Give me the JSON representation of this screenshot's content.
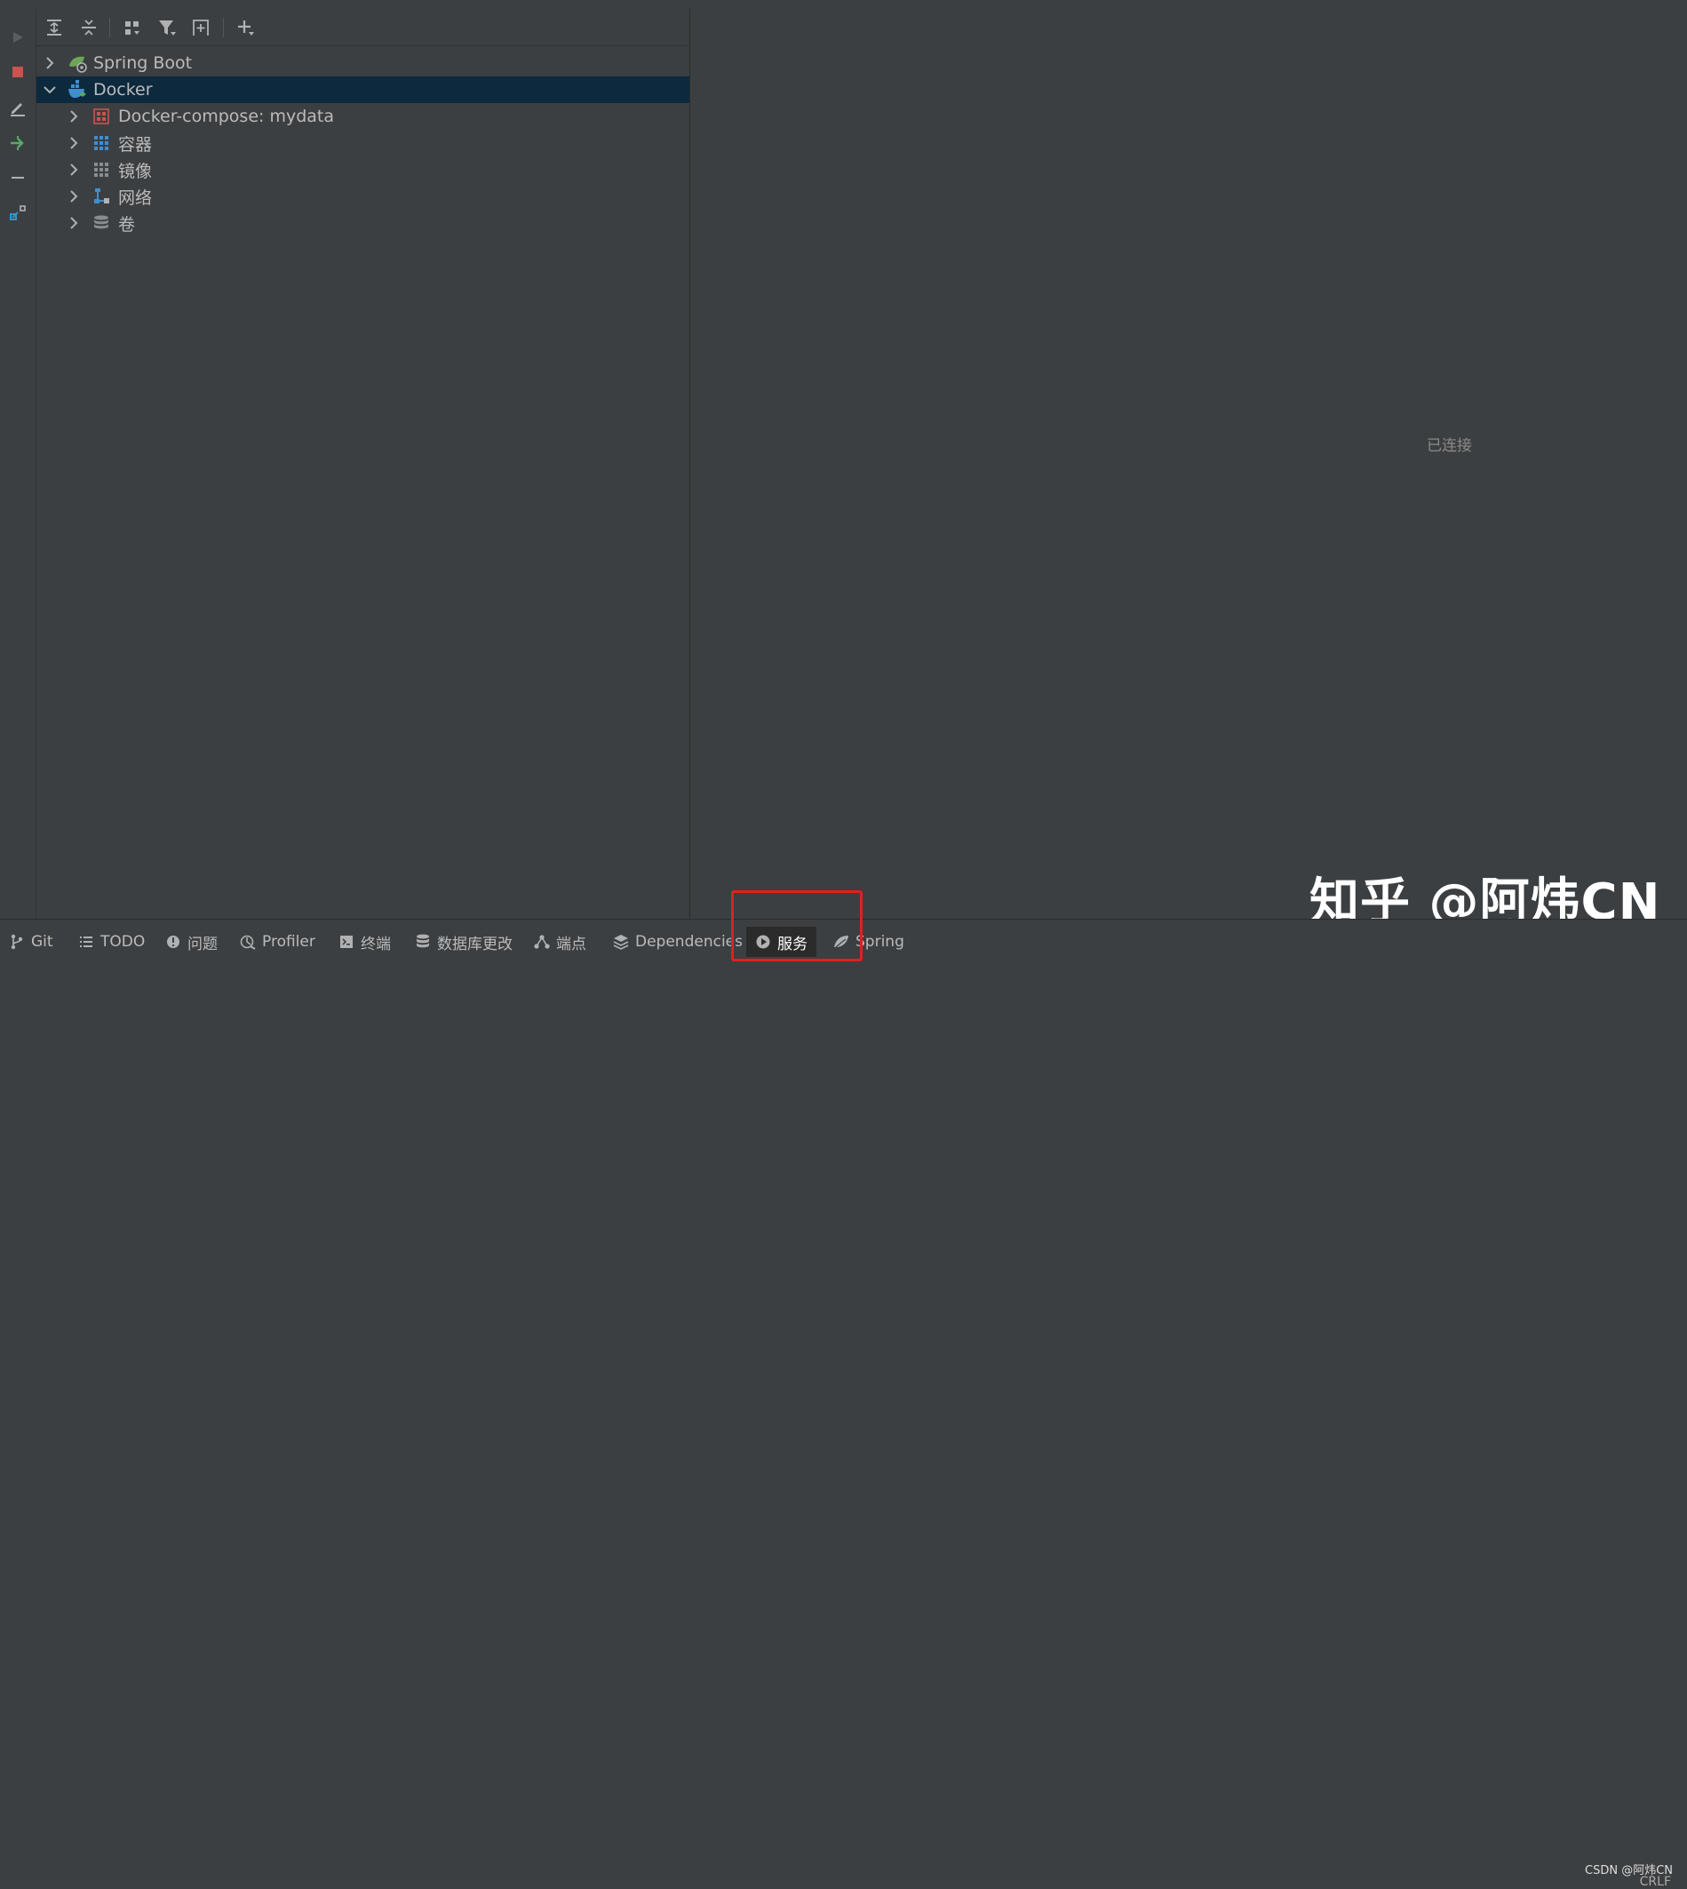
{
  "tree": {
    "items": [
      {
        "label": "Spring Boot",
        "icon": "spring-boot-icon",
        "expanded": false
      },
      {
        "label": "Docker",
        "icon": "docker-icon",
        "expanded": true,
        "selected": true
      },
      {
        "label": "Docker-compose: mydata",
        "icon": "docker-compose-icon",
        "expanded": false
      },
      {
        "label": "容器",
        "icon": "containers-icon",
        "expanded": false
      },
      {
        "label": "镜像",
        "icon": "images-icon",
        "expanded": false
      },
      {
        "label": "网络",
        "icon": "network-icon",
        "expanded": false
      },
      {
        "label": "卷",
        "icon": "volumes-icon",
        "expanded": false
      }
    ]
  },
  "detail": {
    "status": "已连接"
  },
  "bottom_tabs": [
    {
      "label": "Git",
      "icon": "git-branch-icon"
    },
    {
      "label": "TODO",
      "icon": "list-icon"
    },
    {
      "label": "问题",
      "icon": "problems-icon"
    },
    {
      "label": "Profiler",
      "icon": "profiler-icon"
    },
    {
      "label": "终端",
      "icon": "terminal-icon"
    },
    {
      "label": "数据库更改",
      "icon": "database-changes-icon"
    },
    {
      "label": "端点",
      "icon": "endpoints-icon"
    },
    {
      "label": "Dependencies",
      "icon": "dependencies-icon"
    },
    {
      "label": "服务",
      "icon": "services-icon",
      "active": true
    },
    {
      "label": "Spring",
      "icon": "spring-leaf-icon"
    }
  ],
  "watermark": {
    "text": "知乎 @阿炜CN",
    "credit": "CSDN @阿炜CN"
  },
  "statusbar": {
    "line_separator": "CRLF"
  },
  "colors": {
    "background": "#3c3f41",
    "selection": "#0d293e",
    "highlight_box": "#e02020"
  }
}
